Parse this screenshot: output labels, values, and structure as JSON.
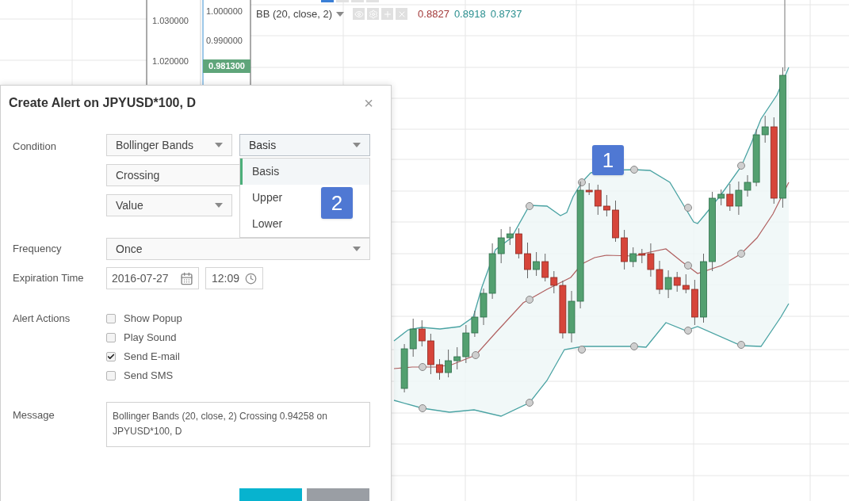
{
  "chart": {
    "left_axis": {
      "ticks": [
        "1.030000",
        "1.020000"
      ]
    },
    "price_axis": {
      "ticks": [
        "1.000000",
        "0.990000"
      ],
      "last_price": "0.981300"
    },
    "legend": {
      "name": "BB (20, close, 2)",
      "values": [
        {
          "text": "0.8827",
          "color": "#a33a3a"
        },
        {
          "text": "0.8918",
          "color": "#2a8f8f"
        },
        {
          "text": "0.8737",
          "color": "#2a8f8f"
        }
      ]
    },
    "marker": "1"
  },
  "dialog": {
    "title": "Create Alert on JPYUSD*100, D",
    "close": "×",
    "condition": {
      "label": "Condition",
      "indicator": "Bollinger Bands",
      "operator": "Crossing",
      "target": "Value",
      "line": {
        "value": "Basis",
        "expanded": true,
        "options": [
          {
            "label": "Basis",
            "selected": true
          },
          {
            "label": "Upper",
            "selected": false
          },
          {
            "label": "Lower",
            "selected": false
          }
        ]
      }
    },
    "marker": "2",
    "frequency": {
      "label": "Frequency",
      "value": "Once"
    },
    "expiration": {
      "label": "Expiration Time",
      "date": "2016-07-27",
      "time": "12:09"
    },
    "actions": {
      "label": "Alert Actions",
      "items": [
        {
          "label": "Show Popup",
          "checked": false
        },
        {
          "label": "Play Sound",
          "checked": false
        },
        {
          "label": "Send E-mail",
          "checked": true
        },
        {
          "label": "Send SMS",
          "checked": false
        }
      ]
    },
    "message": {
      "label": "Message",
      "value": "Bollinger Bands (20, close, 2) Crossing 0.94258 on JPYUSD*100, D"
    }
  }
}
